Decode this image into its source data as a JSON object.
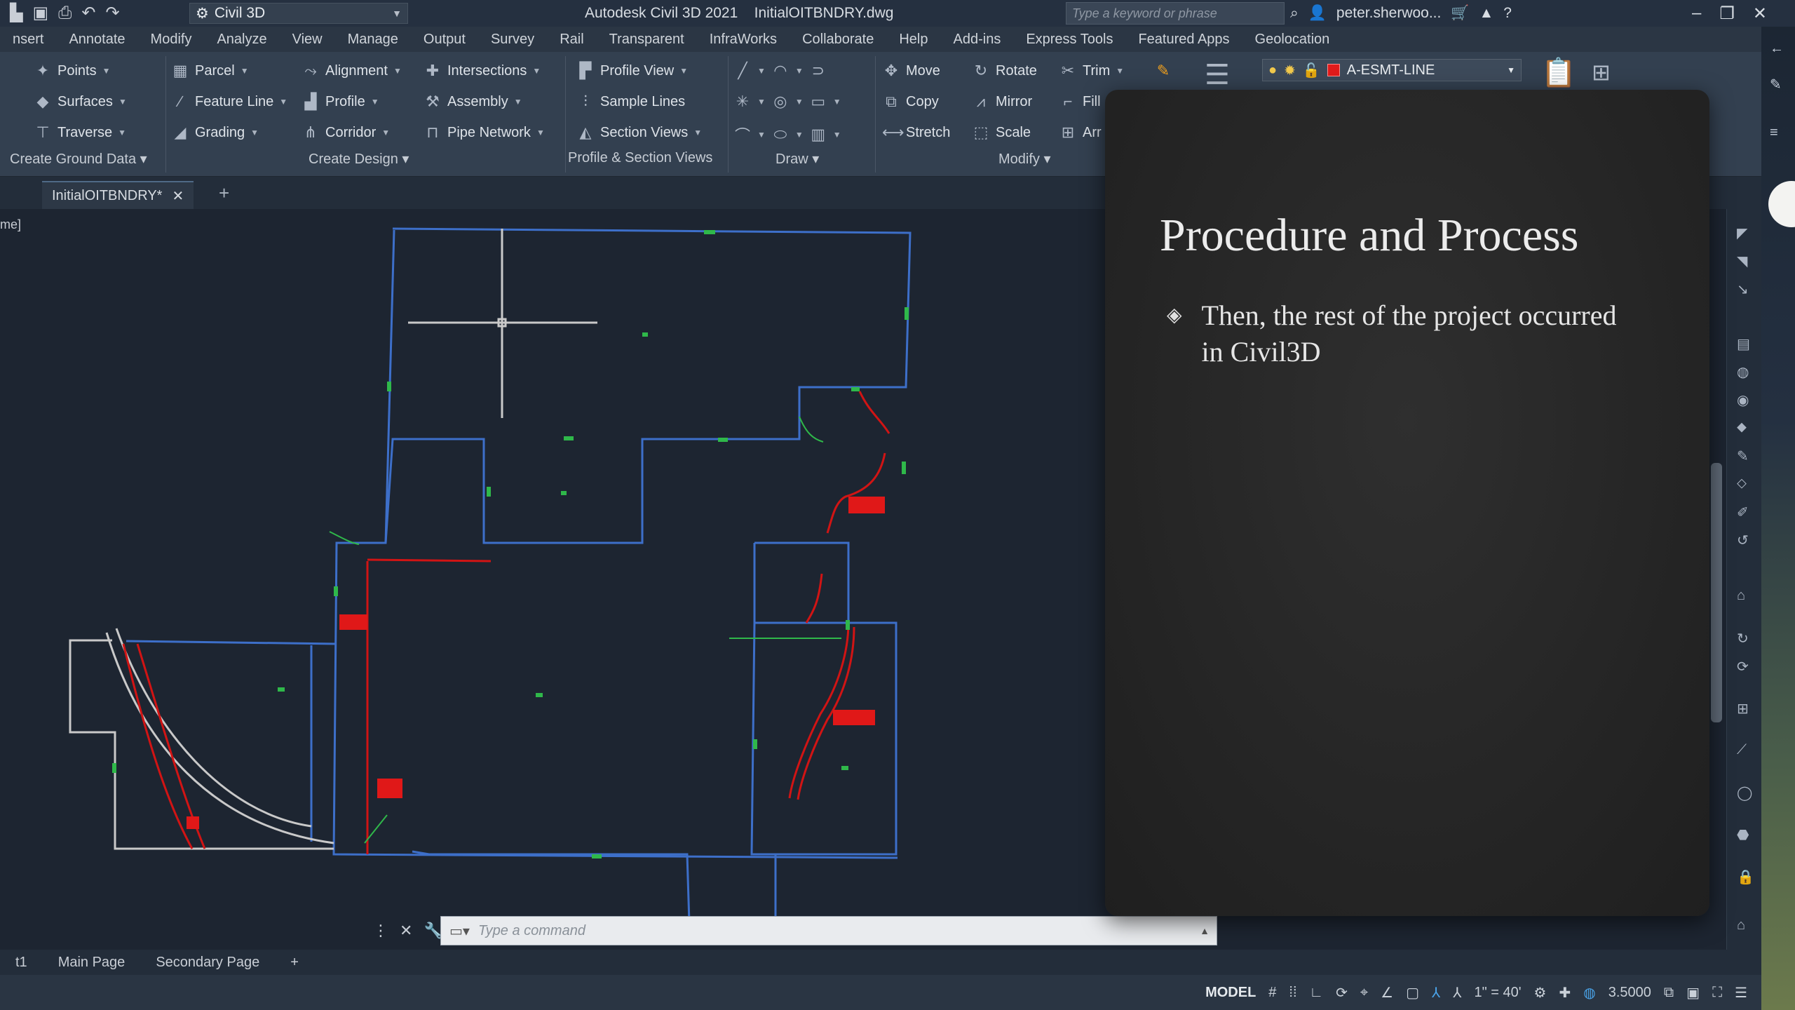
{
  "titlebar": {
    "workspace": "Civil 3D",
    "app_title": "Autodesk Civil 3D 2021",
    "file_name": "InitialOITBNDRY.dwg",
    "search_placeholder": "Type a keyword or phrase",
    "user": "peter.sherwoo..."
  },
  "menubar": {
    "items": [
      "nsert",
      "Annotate",
      "Modify",
      "Analyze",
      "View",
      "Manage",
      "Output",
      "Survey",
      "Rail",
      "Transparent",
      "InfraWorks",
      "Collaborate",
      "Help",
      "Add-ins",
      "Express Tools",
      "Featured Apps",
      "Geolocation"
    ]
  },
  "ribbon": {
    "ground": {
      "points": "Points",
      "surfaces": "Surfaces",
      "traverse": "Traverse",
      "label": "Create Ground Data"
    },
    "design": {
      "parcel": "Parcel",
      "feature_line": "Feature Line",
      "grading": "Grading",
      "alignment": "Alignment",
      "profile": "Profile",
      "corridor": "Corridor",
      "intersections": "Intersections",
      "assembly": "Assembly",
      "pipe_network": "Pipe Network",
      "label": "Create Design"
    },
    "profile_section": {
      "profile_view": "Profile View",
      "sample_lines": "Sample Lines",
      "section_views": "Section Views",
      "label": "Profile & Section Views"
    },
    "draw": {
      "label": "Draw"
    },
    "modify": {
      "move": "Move",
      "copy": "Copy",
      "stretch": "Stretch",
      "rotate": "Rotate",
      "mirror": "Mirror",
      "scale": "Scale",
      "trim": "Trim",
      "fill": "Fill",
      "array": "Arr",
      "label": "Modify"
    },
    "layer": {
      "name": "A-ESMT-LINE",
      "color": "#e21b1b"
    }
  },
  "file_tab": {
    "name": "InitialOITBNDRY*"
  },
  "viewport_label": "me]",
  "command_line": {
    "placeholder": "Type a command"
  },
  "layout_tabs": [
    "t1",
    "Main Page",
    "Secondary Page"
  ],
  "statusbar": {
    "model": "MODEL",
    "scale": "1\" = 40'",
    "value": "3.5000"
  },
  "slide": {
    "title": "Procedure and Process",
    "bullet": "Then, the rest of the project occurred in Civil3D"
  },
  "colors": {
    "lot_lines": "#3d6fc9",
    "easement": "#d11414",
    "points": "#2fb84a",
    "boundary": "#c9c9c9"
  }
}
